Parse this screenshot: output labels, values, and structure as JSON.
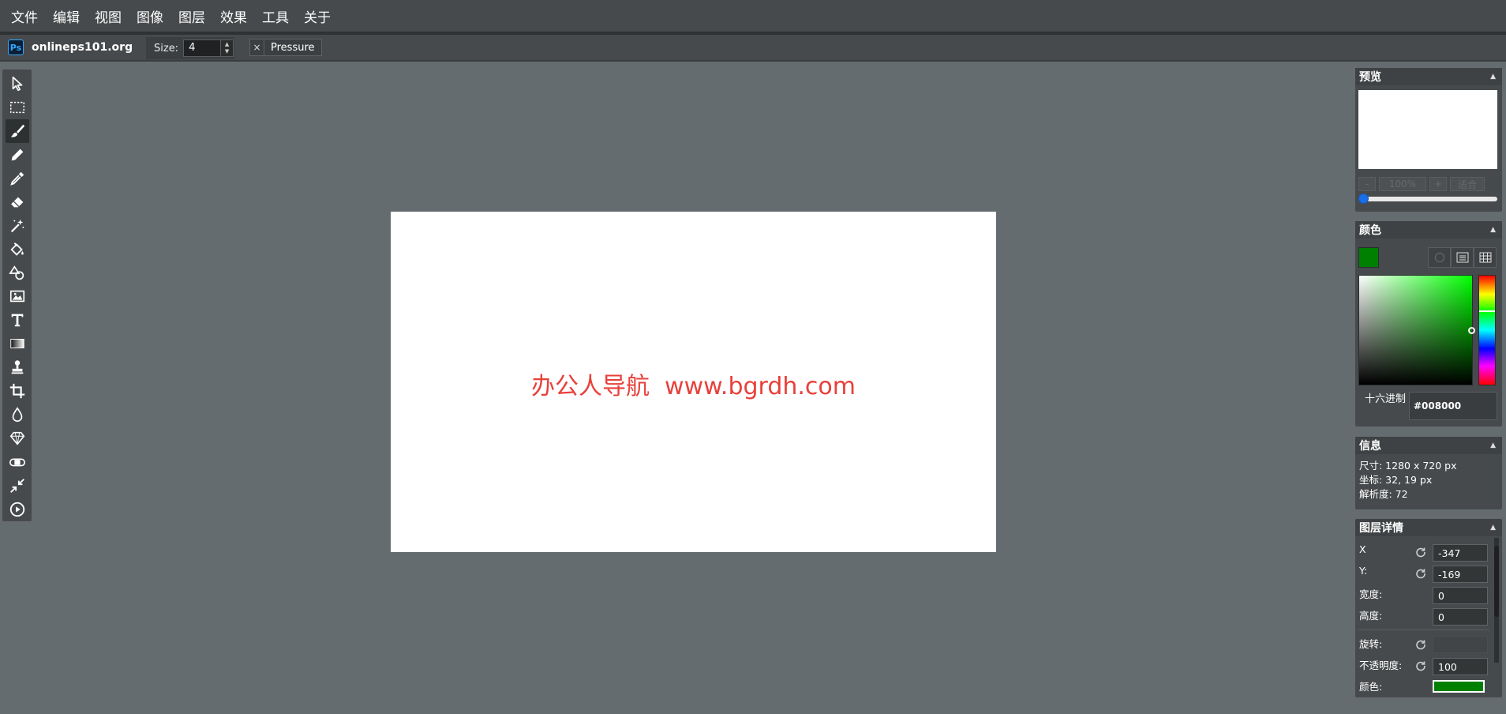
{
  "menu": [
    "文件",
    "编辑",
    "视图",
    "图像",
    "图层",
    "效果",
    "工具",
    "关于"
  ],
  "options": {
    "logo_text": "Ps",
    "site": "onlineps101.org",
    "size_label": "Size:",
    "size_value": "4",
    "pressure_close": "×",
    "pressure_label": "Pressure"
  },
  "tools": [
    {
      "name": "move-tool",
      "icon": "cursor-arrow-icon"
    },
    {
      "name": "marquee-tool",
      "icon": "dashed-rect-icon"
    },
    {
      "name": "brush-tool",
      "icon": "paintbrush-icon",
      "active": true
    },
    {
      "name": "pencil-tool",
      "icon": "pencil-icon"
    },
    {
      "name": "eyedropper-tool",
      "icon": "eyedropper-icon"
    },
    {
      "name": "eraser-tool",
      "icon": "eraser-icon"
    },
    {
      "name": "magic-wand-tool",
      "icon": "magic-wand-icon"
    },
    {
      "name": "fill-tool",
      "icon": "paint-bucket-icon"
    },
    {
      "name": "shapes-tool",
      "icon": "shapes-icon"
    },
    {
      "name": "image-tool",
      "icon": "image-icon"
    },
    {
      "name": "text-tool",
      "icon": "text-icon"
    },
    {
      "name": "gradient-tool",
      "icon": "gradient-icon"
    },
    {
      "name": "stamp-tool",
      "icon": "stamp-icon"
    },
    {
      "name": "crop-tool",
      "icon": "crop-icon"
    },
    {
      "name": "blur-tool",
      "icon": "droplet-icon"
    },
    {
      "name": "sharpen-tool",
      "icon": "diamond-icon"
    },
    {
      "name": "smudge-tool",
      "icon": "bandage-icon"
    },
    {
      "name": "resize-tool",
      "icon": "shrink-arrows-icon"
    },
    {
      "name": "animation-tool",
      "icon": "play-circle-icon"
    }
  ],
  "canvas": {
    "text": "办公人导航  www.bgrdh.com",
    "text_color": "#e8403a"
  },
  "preview": {
    "title": "预览",
    "zoom_out": "-",
    "zoom_value": "100%",
    "zoom_in": "+",
    "fit": "适合",
    "zoom_slider_value": 0
  },
  "color": {
    "title": "颜色",
    "current": "#008000",
    "hex_label": "十六进制",
    "hex_value": "#008000"
  },
  "info": {
    "title": "信息",
    "size": "尺寸:   1280 x 720 px",
    "coords": "坐标:   32, 19 px",
    "resolution": "解析度:   72"
  },
  "layer": {
    "title": "图层详情",
    "x_label": "X",
    "x_value": "-347",
    "y_label": "Y:",
    "y_value": "-169",
    "width_label": "宽度:",
    "width_value": "0",
    "height_label": "高度:",
    "height_value": "0",
    "rotate_label": "旋转:",
    "rotate_value": "",
    "opacity_label": "不透明度:",
    "opacity_value": "100",
    "color_label": "颜色:",
    "color_value": "#008000"
  },
  "colors": {
    "menubar_bg": "#474a4c",
    "workspace_bg": "#656c6f",
    "panel_bg": "#474a4c",
    "accent_blue": "#1a6fe8"
  }
}
